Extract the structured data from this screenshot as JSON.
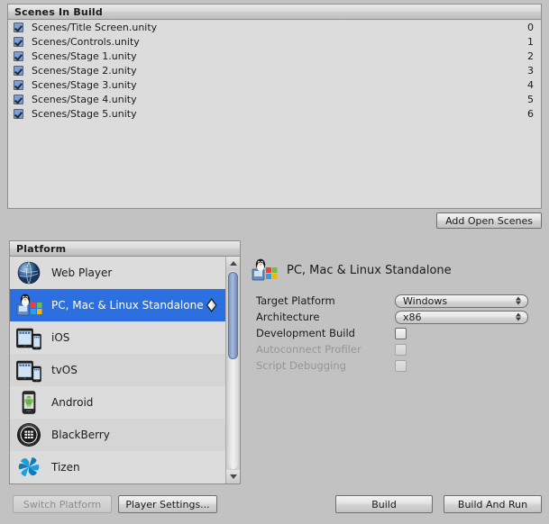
{
  "window": {
    "background_color": "#c2c2c2",
    "panel_color": "#dcdcdc",
    "accent_color": "#2b6fe0"
  },
  "scenes_panel": {
    "header": "Scenes In Build",
    "scenes": [
      {
        "name": "Scenes/Title Screen.unity",
        "index": "0",
        "checked": true
      },
      {
        "name": "Scenes/Controls.unity",
        "index": "1",
        "checked": true
      },
      {
        "name": "Scenes/Stage 1.unity",
        "index": "2",
        "checked": true
      },
      {
        "name": "Scenes/Stage 2.unity",
        "index": "3",
        "checked": true
      },
      {
        "name": "Scenes/Stage 3.unity",
        "index": "4",
        "checked": true
      },
      {
        "name": "Scenes/Stage 4.unity",
        "index": "5",
        "checked": true
      },
      {
        "name": "Scenes/Stage 5.unity",
        "index": "6",
        "checked": true
      }
    ],
    "add_open_scenes_label": "Add Open Scenes"
  },
  "platform_panel": {
    "header": "Platform",
    "platforms": [
      {
        "label": "Web Player",
        "icon": "web-player-icon",
        "selected": false
      },
      {
        "label": "PC, Mac & Linux Standalone",
        "icon": "standalone-icon",
        "selected": true
      },
      {
        "label": "iOS",
        "icon": "ios-icon",
        "selected": false
      },
      {
        "label": "tvOS",
        "icon": "tvos-icon",
        "selected": false
      },
      {
        "label": "Android",
        "icon": "android-icon",
        "selected": false
      },
      {
        "label": "BlackBerry",
        "icon": "blackberry-icon",
        "selected": false
      },
      {
        "label": "Tizen",
        "icon": "tizen-icon",
        "selected": false
      }
    ],
    "scrollbar": {
      "up_icon": "scroll-up-arrow-icon",
      "down_icon": "scroll-down-arrow-icon"
    }
  },
  "settings_panel": {
    "title": "PC, Mac & Linux Standalone",
    "title_icon": "standalone-icon",
    "fields": [
      {
        "label": "Target Platform",
        "type": "dropdown",
        "value": "Windows",
        "disabled": false
      },
      {
        "label": "Architecture",
        "type": "dropdown",
        "value": "x86",
        "disabled": false
      },
      {
        "label": "Development Build",
        "type": "checkbox",
        "checked": false,
        "disabled": false
      },
      {
        "label": "Autoconnect Profiler",
        "type": "checkbox",
        "checked": false,
        "disabled": true
      },
      {
        "label": "Script Debugging",
        "type": "checkbox",
        "checked": false,
        "disabled": true
      }
    ]
  },
  "footer": {
    "switch_platform_label": "Switch Platform",
    "switch_platform_disabled": true,
    "player_settings_label": "Player Settings...",
    "build_label": "Build",
    "build_and_run_label": "Build And Run"
  }
}
